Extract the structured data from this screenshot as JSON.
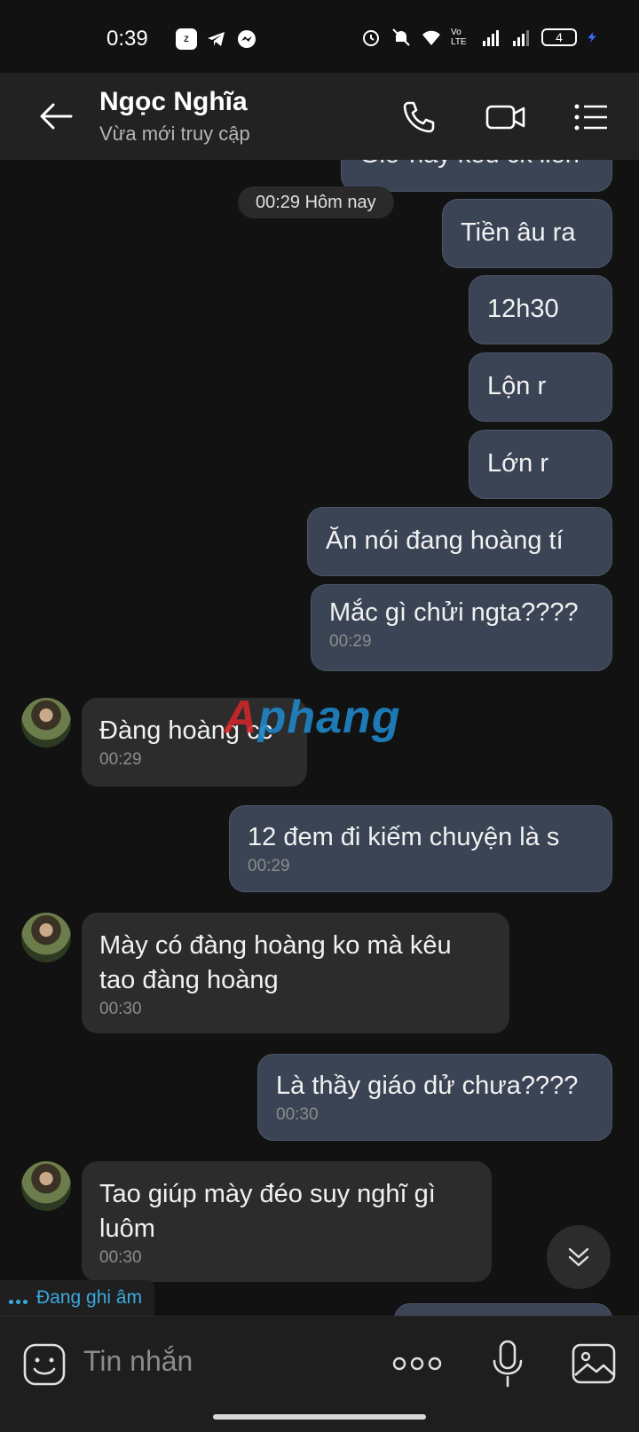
{
  "status_bar": {
    "time": "0:39",
    "battery": "4",
    "network_label": "Vo LTE"
  },
  "header": {
    "contact_name": "Ngọc Nghĩa",
    "status": "Vừa mới truy cập"
  },
  "chat": {
    "date_chip": "00:29 Hôm nay",
    "watermark": "Aphang",
    "messages": [
      {
        "side": "me",
        "text": "Giờ này kêu ck liền",
        "time": ""
      },
      {
        "side": "me",
        "text": "Tiền âu ra",
        "time": ""
      },
      {
        "side": "me",
        "text": "12h30",
        "time": ""
      },
      {
        "side": "me",
        "text": "Lộn r",
        "time": ""
      },
      {
        "side": "me",
        "text": "Lớn r",
        "time": ""
      },
      {
        "side": "me",
        "text": "Ăn nói đang hoàng tí",
        "time": ""
      },
      {
        "side": "me",
        "text": "Mắc gì chửi ngta????",
        "time": "00:29"
      },
      {
        "side": "them",
        "text": "Đàng hoàng cc",
        "time": "00:29"
      },
      {
        "side": "me",
        "text": "12 đem đi kiếm chuyện là s",
        "time": "00:29"
      },
      {
        "side": "them",
        "text": "Mày có đàng hoàng ko mà kêu tao đàng hoàng",
        "time": "00:30"
      },
      {
        "side": "me",
        "text": "Là thầy giáo dử chưa????",
        "time": "00:30"
      },
      {
        "side": "them",
        "text": "Tao giúp mày đéo suy nghĩ gì luôm",
        "time": "00:30"
      }
    ],
    "recording_label": "Đang ghi âm"
  },
  "input": {
    "placeholder": "Tin nhắn"
  },
  "colors": {
    "background": "#121212",
    "header": "#222222",
    "my_bubble": "#3a4454",
    "their_bubble": "#2c2c2c",
    "accent": "#39a9e0"
  }
}
